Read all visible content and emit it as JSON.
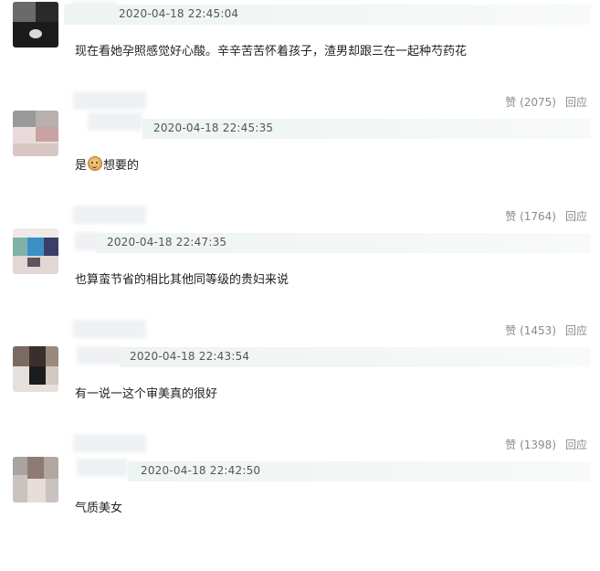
{
  "comments": [
    {
      "timestamp": "2020-04-18 22:45:04",
      "text": "现在看她孕照感觉好心酸。辛辛苦苦怀着孩子，渣男却跟三在一起种芍药花",
      "likes_label": "赞 (2075)",
      "reply_label": "回应"
    },
    {
      "timestamp": "2020-04-18 22:45:35",
      "text_before": "是",
      "emoji_name": "smile-emoji-icon",
      "text_after": "想要的",
      "likes_label": "赞 (1764)",
      "reply_label": "回应"
    },
    {
      "timestamp": "2020-04-18 22:47:35",
      "text": "也算蛮节省的相比其他同等级的贵妇来说",
      "likes_label": "赞 (1453)",
      "reply_label": "回应"
    },
    {
      "timestamp": "2020-04-18 22:43:54",
      "text": "有一说一这个审美真的很好",
      "likes_label": "赞 (1398)",
      "reply_label": "回应"
    },
    {
      "timestamp": "2020-04-18 22:42:50",
      "text": "气质美女"
    }
  ]
}
